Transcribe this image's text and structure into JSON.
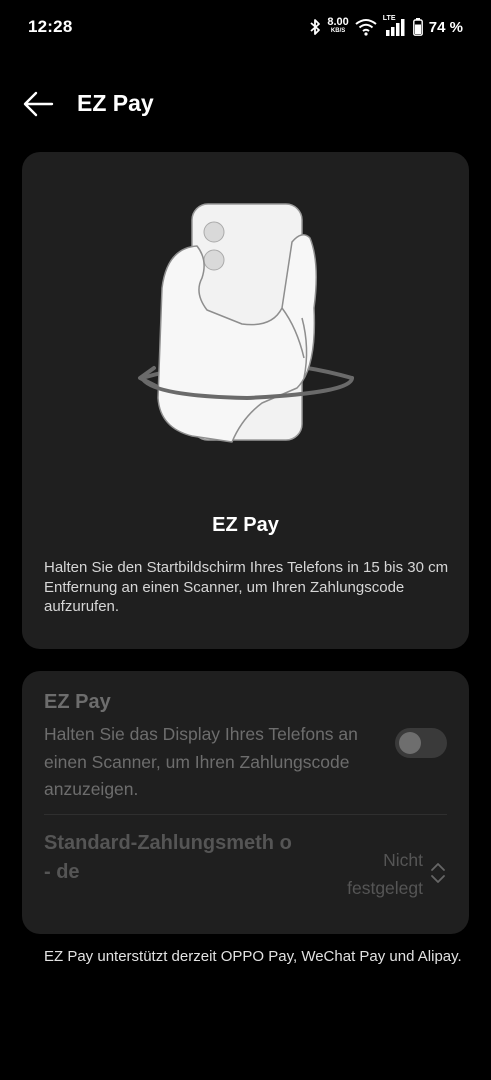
{
  "status_bar": {
    "time": "12:28",
    "net_speed_value": "8.00",
    "net_speed_unit": "KB/S",
    "network_type": "LTE",
    "battery": "74 %",
    "icons": [
      "bluetooth-icon",
      "wifi-icon",
      "signal-icon",
      "battery-icon"
    ]
  },
  "header": {
    "title": "EZ Pay",
    "back_icon": "arrow-left-icon"
  },
  "hero": {
    "illustration": "hand-holding-phone-rotate",
    "title": "EZ Pay",
    "description": "Halten Sie den Startbildschirm Ihres Telefons in 15 bis 30 cm Entfernung an einen Scanner, um Ihren Zahlungscode aufzurufen."
  },
  "settings": {
    "ezpay": {
      "title": "EZ Pay",
      "description": "Halten Sie das Display Ihres Telefons an einen Scanner, um Ihren Zahlungscode anzuzeigen.",
      "enabled": false
    },
    "default_method": {
      "label": "Standard-Zahlungsmeth o- de",
      "value": "Nicht festgelegt",
      "icon": "chevron-updown-icon"
    }
  },
  "footnote": "EZ Pay unterstützt derzeit OPPO Pay, WeChat Pay und Alipay.",
  "colors": {
    "background": "#000000",
    "card": "#1f1f1f",
    "disabled_text": "#6d6d6d"
  }
}
